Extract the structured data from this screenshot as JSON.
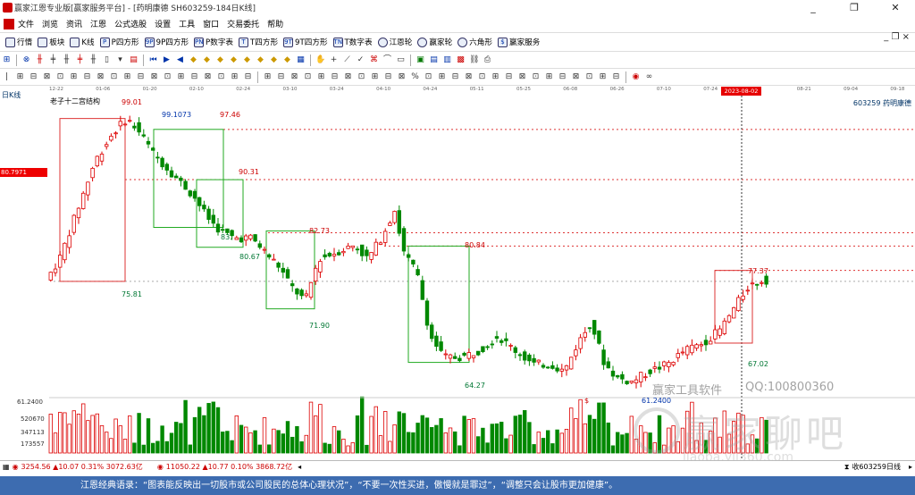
{
  "window": {
    "title": "赢家江恩专业版[赢家服务平台] - [药明康德  SH603259-184日K线]",
    "minimize": "_",
    "restore": "❐",
    "close": "✕"
  },
  "menu": {
    "items": [
      "文件",
      "浏览",
      "资讯",
      "江恩",
      "公式选股",
      "设置",
      "工具",
      "窗口",
      "交易委托",
      "帮助"
    ],
    "mdi": "_ ❐ ×"
  },
  "toolbar1": [
    {
      "icon": "grid",
      "label": "行情"
    },
    {
      "icon": "blocks",
      "label": "板块"
    },
    {
      "icon": "kline",
      "label": "K线"
    },
    {
      "icon": "P",
      "label": "P四方形"
    },
    {
      "icon": "9P",
      "label": "9P四方形"
    },
    {
      "icon": "PN",
      "label": "P数字表"
    },
    {
      "icon": "T",
      "label": "T四方形"
    },
    {
      "icon": "9T",
      "label": "9T四方形"
    },
    {
      "icon": "TN",
      "label": "T数字表"
    },
    {
      "icon": "wheel",
      "label": "江恩轮"
    },
    {
      "icon": "wheel",
      "label": "赢家轮"
    },
    {
      "icon": "star",
      "label": "六角形"
    },
    {
      "icon": "$",
      "label": "赢家服务"
    }
  ],
  "dates": [
    "12-22",
    "01-06",
    "01-20",
    "02-10",
    "02-24",
    "03-10",
    "03-24",
    "04-10",
    "04-24",
    "05-11",
    "05-25",
    "06-08",
    "06-26",
    "07-10",
    "07-24",
    "2023-08-02",
    "08-21",
    "09-04",
    "09-18"
  ],
  "period": "日K线",
  "stock": "603259  药明康德",
  "structure_label": "老子十二宫结构",
  "current_price": "80.7971",
  "price_labels": {
    "p99_01": "99.01",
    "p99_1073": "99.1073",
    "p97_46": "97.46",
    "p90_31": "90.31",
    "p83": "83.",
    "p82_73": "82.73",
    "p80_84": "80.84",
    "p80_67": "80.67",
    "p77_37": "77.37",
    "p75_81": "75.81",
    "p71_90": "71.90",
    "p67_02": "67.02",
    "p64_27": "64.27",
    "p61_2400": "61.2400",
    "dollar": "$"
  },
  "volume_axis": {
    "v1": "61.2400",
    "v2": "520670",
    "v3": "347113",
    "v4": "173557"
  },
  "watermark": {
    "a": "赢家工具软件",
    "b": "QQ:100800360",
    "c": "赢家聊吧",
    "d": "liaoba.yjj360.com"
  },
  "status": {
    "sh": "3254.56 ▲10.07 0.31% 3072.63亿",
    "sz": "11050.22 ▲10.77 0.10% 3868.72亿",
    "right": "收603259日线"
  },
  "quote": "江恩经典语录：“图表能反映出一切股市或公司股民的总体心理状况”，“不要一次性买进，傲慢就是罪过”，“调整只会让股市更加健康”。",
  "colors": {
    "up": "#dd0000",
    "down": "#008800",
    "accent": "#3d6cb0"
  },
  "price_scale": {
    "max": 101,
    "min": 59
  }
}
